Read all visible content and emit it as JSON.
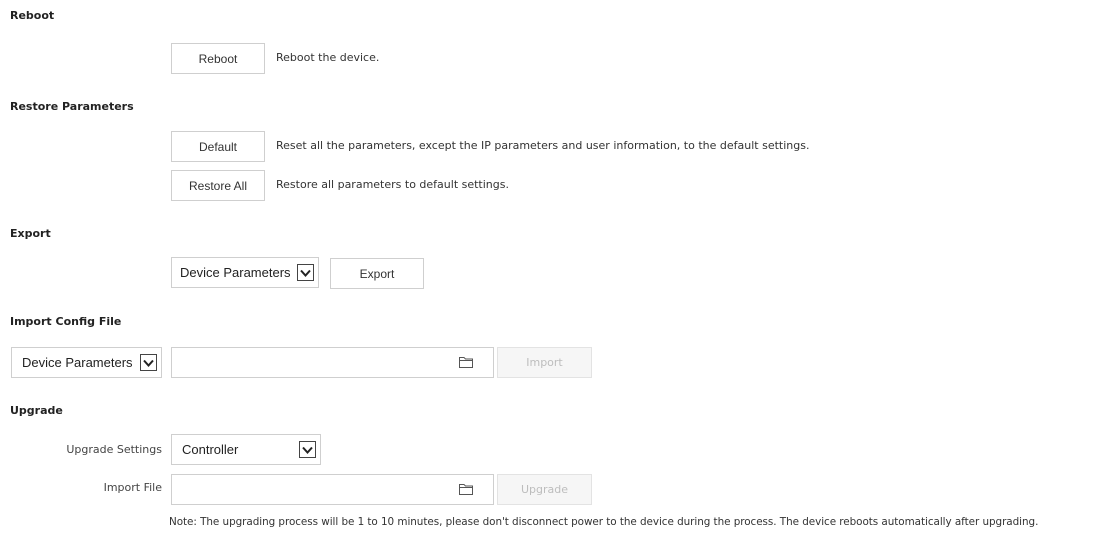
{
  "reboot": {
    "heading": "Reboot",
    "button": "Reboot",
    "description": "Reboot the device."
  },
  "restore": {
    "heading": "Restore Parameters",
    "default_button": "Default",
    "default_description": "Reset all the parameters, except the IP parameters and user information, to the default settings.",
    "restore_all_button": "Restore All",
    "restore_all_description": "Restore all parameters to default settings."
  },
  "export": {
    "heading": "Export",
    "select_value": "Device Parameters",
    "button": "Export"
  },
  "import_config": {
    "heading": "Import Config File",
    "select_value": "Device Parameters",
    "file_value": "",
    "button": "Import"
  },
  "upgrade": {
    "heading": "Upgrade",
    "settings_label": "Upgrade Settings",
    "settings_value": "Controller",
    "import_file_label": "Import File",
    "file_value": "",
    "button": "Upgrade",
    "note": "Note: The upgrading process will be 1 to 10 minutes, please don't disconnect power to the device during the process. The device reboots automatically after upgrading."
  },
  "icons": {
    "dropdown": "chevron-down-icon",
    "folder": "folder-icon"
  }
}
